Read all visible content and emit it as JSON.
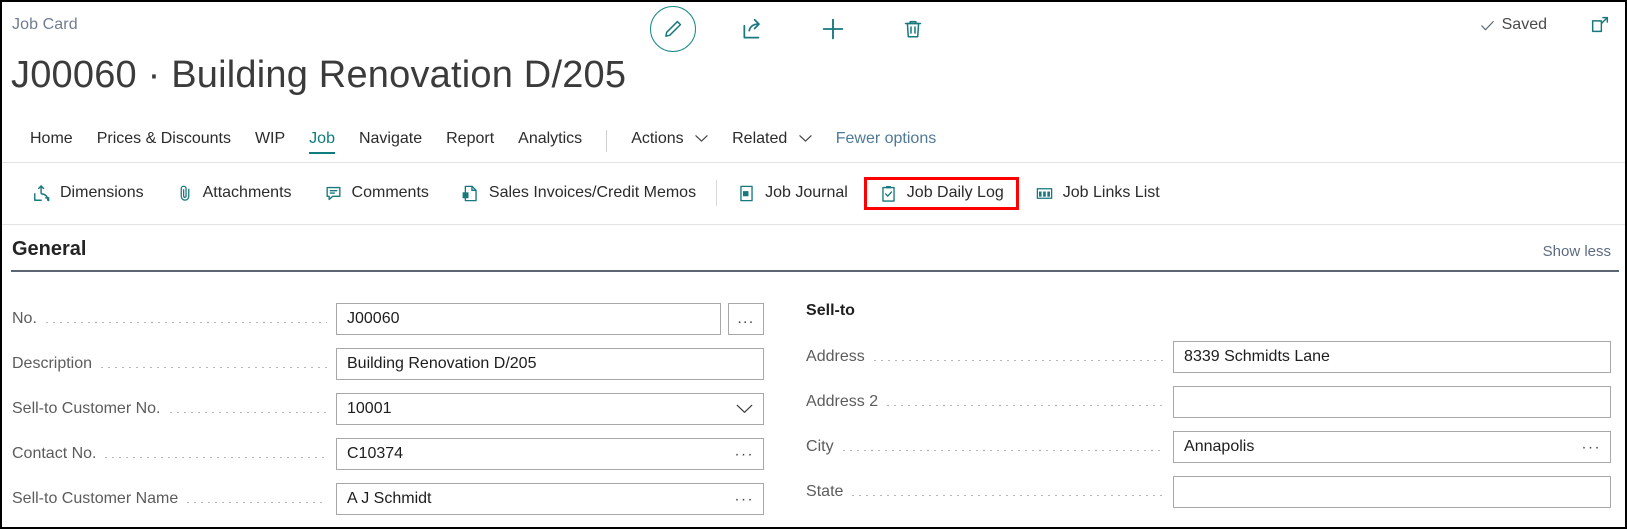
{
  "breadcrumb": "Job Card",
  "title": "J00060 · Building Renovation D/205",
  "colors": {
    "accent_teal": "#17787d",
    "active_tab": "#0f7d7d",
    "highlight_red": "#fe0000",
    "label_gray": "#5c5c5c"
  },
  "topbar": {
    "edit_label": "Edit",
    "share_label": "Share",
    "new_label": "New",
    "delete_label": "Delete",
    "saved_label": "Saved",
    "open_new_window_label": "Open in new window"
  },
  "nav": {
    "items": [
      {
        "label": "Home",
        "active": false
      },
      {
        "label": "Prices & Discounts",
        "active": false
      },
      {
        "label": "WIP",
        "active": false
      },
      {
        "label": "Job",
        "active": true
      },
      {
        "label": "Navigate",
        "active": false
      },
      {
        "label": "Report",
        "active": false
      },
      {
        "label": "Analytics",
        "active": false
      }
    ],
    "menus": [
      {
        "label": "Actions"
      },
      {
        "label": "Related"
      }
    ],
    "fewer_options": "Fewer options"
  },
  "actions": [
    {
      "label": "Dimensions",
      "icon": "dimensions-icon",
      "highlighted": false
    },
    {
      "label": "Attachments",
      "icon": "paperclip-icon",
      "highlighted": false
    },
    {
      "label": "Comments",
      "icon": "comment-icon",
      "highlighted": false
    },
    {
      "label": "Sales Invoices/Credit Memos",
      "icon": "document-arrow-icon",
      "highlighted": false
    },
    {
      "label": "Job Journal",
      "icon": "journal-icon",
      "highlighted": false
    },
    {
      "label": "Job Daily Log",
      "icon": "clipboard-check-icon",
      "highlighted": true
    },
    {
      "label": "Job Links List",
      "icon": "table-columns-icon",
      "highlighted": false
    }
  ],
  "general": {
    "heading": "General",
    "show_less": "Show less",
    "left_fields": [
      {
        "label": "No.",
        "value": "J00060",
        "control": "text-assist",
        "assist": "..."
      },
      {
        "label": "Description",
        "value": "Building Renovation D/205",
        "control": "text"
      },
      {
        "label": "Sell-to Customer No.",
        "value": "10001",
        "control": "dropdown"
      },
      {
        "label": "Contact No.",
        "value": "C10374",
        "control": "text-ellipsis"
      },
      {
        "label": "Sell-to Customer Name",
        "value": "A J Schmidt",
        "control": "text-ellipsis"
      }
    ],
    "right_heading": "Sell-to",
    "right_fields": [
      {
        "label": "Address",
        "value": "8339 Schmidts Lane",
        "control": "text"
      },
      {
        "label": "Address 2",
        "value": "",
        "control": "text"
      },
      {
        "label": "City",
        "value": "Annapolis",
        "control": "text-ellipsis"
      },
      {
        "label": "State",
        "value": "",
        "control": "text"
      }
    ]
  }
}
